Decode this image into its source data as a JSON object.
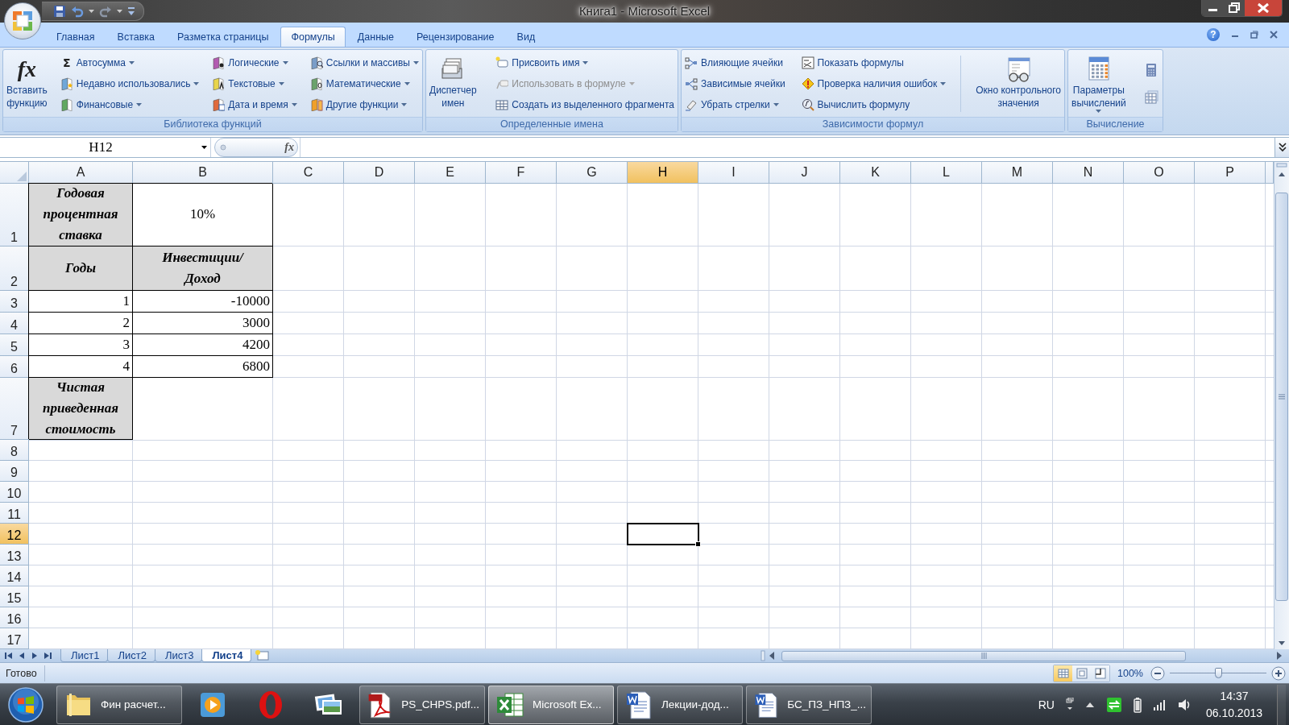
{
  "window": {
    "title": "Книга1 - Microsoft Excel"
  },
  "ribbon": {
    "help_glyph": "?",
    "tabs": [
      {
        "label": "Главная",
        "selected": false
      },
      {
        "label": "Вставка",
        "selected": false
      },
      {
        "label": "Разметка страницы",
        "selected": false
      },
      {
        "label": "Формулы",
        "selected": true
      },
      {
        "label": "Данные",
        "selected": false
      },
      {
        "label": "Рецензирование",
        "selected": false
      },
      {
        "label": "Вид",
        "selected": false
      }
    ],
    "groups": [
      {
        "title": "Библиотека функций",
        "parts": [
          {
            "kind": "large",
            "label": "Вставить\nфункцию",
            "glyph": "fx",
            "dropdown": false
          },
          {
            "kind": "column",
            "items": [
              {
                "label": "Автосумма",
                "glyph": "Σ",
                "dropdown": true,
                "disabled": false
              },
              {
                "label": "Недавно использовались",
                "dropdown": true,
                "disabled": false
              },
              {
                "label": "Финансовые",
                "dropdown": true,
                "disabled": false
              }
            ]
          },
          {
            "kind": "column",
            "items": [
              {
                "label": "Логические",
                "dropdown": true,
                "disabled": false
              },
              {
                "label": "Текстовые",
                "dropdown": true,
                "disabled": false
              },
              {
                "label": "Дата и время",
                "dropdown": true,
                "disabled": false
              }
            ]
          },
          {
            "kind": "column",
            "items": [
              {
                "label": "Ссылки и массивы",
                "dropdown": true,
                "disabled": false
              },
              {
                "label": "Математические",
                "dropdown": true,
                "disabled": false
              },
              {
                "label": "Другие функции",
                "dropdown": true,
                "disabled": false
              }
            ]
          }
        ]
      },
      {
        "title": "Определенные имена",
        "parts": [
          {
            "kind": "large",
            "label": "Диспетчер\nимен",
            "dropdown": false
          },
          {
            "kind": "column",
            "items": [
              {
                "label": "Присвоить имя",
                "dropdown": true,
                "disabled": false
              },
              {
                "label": "Использовать в формуле",
                "dropdown": true,
                "disabled": true
              },
              {
                "label": "Создать из выделенного фрагмента",
                "dropdown": false,
                "disabled": false
              }
            ]
          }
        ]
      },
      {
        "title": "Зависимости формул",
        "parts": [
          {
            "kind": "column",
            "items": [
              {
                "label": "Влияющие ячейки",
                "dropdown": false,
                "disabled": false
              },
              {
                "label": "Зависимые ячейки",
                "dropdown": false,
                "disabled": false
              },
              {
                "label": "Убрать стрелки",
                "dropdown": true,
                "disabled": false
              }
            ]
          },
          {
            "kind": "column",
            "items": [
              {
                "label": "Показать формулы",
                "dropdown": false,
                "disabled": false
              },
              {
                "label": "Проверка наличия ошибок",
                "dropdown": true,
                "disabled": false
              },
              {
                "label": "Вычислить формулу",
                "dropdown": false,
                "disabled": false
              }
            ]
          },
          {
            "kind": "separator"
          },
          {
            "kind": "large",
            "label": "Окно контрольного\nзначения",
            "dropdown": false
          }
        ]
      },
      {
        "title": "Вычисление",
        "parts": [
          {
            "kind": "large",
            "label": "Параметры\nвычислений",
            "dropdown": true
          },
          {
            "kind": "icons",
            "items": [
              {
                "kind": "calculator"
              },
              {
                "kind": "sheet"
              }
            ]
          }
        ]
      }
    ]
  },
  "formula_bar": {
    "name_box": "H12",
    "fx_glyph": "fx"
  },
  "sheet": {
    "columns": [
      {
        "label": "A",
        "selected": false
      },
      {
        "label": "B",
        "selected": false
      },
      {
        "label": "C",
        "selected": false
      },
      {
        "label": "D",
        "selected": false
      },
      {
        "label": "E",
        "selected": false
      },
      {
        "label": "F",
        "selected": false
      },
      {
        "label": "G",
        "selected": false
      },
      {
        "label": "H",
        "selected": true
      },
      {
        "label": "I",
        "selected": false
      },
      {
        "label": "J",
        "selected": false
      },
      {
        "label": "K",
        "selected": false
      },
      {
        "label": "L",
        "selected": false
      },
      {
        "label": "M",
        "selected": false
      },
      {
        "label": "N",
        "selected": false
      },
      {
        "label": "O",
        "selected": false
      },
      {
        "label": "P",
        "selected": false
      }
    ],
    "rows": [
      {
        "label": "1",
        "selected": false,
        "cells": [
          {
            "kind": "heading",
            "text": "Годовая процентная ставка"
          },
          {
            "kind": "text",
            "text": "10%"
          }
        ]
      },
      {
        "label": "2",
        "selected": false,
        "cells": [
          {
            "kind": "heading",
            "text": "Годы"
          },
          {
            "kind": "heading",
            "text": "Инвестиции/ Доход"
          }
        ]
      },
      {
        "label": "3",
        "selected": false,
        "cells": [
          {
            "kind": "number",
            "text": "1"
          },
          {
            "kind": "number",
            "text": "-10000"
          }
        ]
      },
      {
        "label": "4",
        "selected": false,
        "cells": [
          {
            "kind": "number",
            "text": "2"
          },
          {
            "kind": "number",
            "text": "3000"
          }
        ]
      },
      {
        "label": "5",
        "selected": false,
        "cells": [
          {
            "kind": "number",
            "text": "3"
          },
          {
            "kind": "number",
            "text": "4200"
          }
        ]
      },
      {
        "label": "6",
        "selected": false,
        "cells": [
          {
            "kind": "number",
            "text": "4"
          },
          {
            "kind": "number",
            "text": "6800"
          }
        ]
      },
      {
        "label": "7",
        "selected": false,
        "cells": [
          {
            "kind": "heading",
            "text": "Чистая приведенная стоимость"
          }
        ]
      },
      {
        "label": "8",
        "selected": false
      },
      {
        "label": "9",
        "selected": false
      },
      {
        "label": "10",
        "selected": false
      },
      {
        "label": "11",
        "selected": false
      },
      {
        "label": "12",
        "selected": true
      },
      {
        "label": "13",
        "selected": false
      },
      {
        "label": "14",
        "selected": false
      },
      {
        "label": "15",
        "selected": false
      },
      {
        "label": "16",
        "selected": false
      },
      {
        "label": "17",
        "selected": false
      }
    ]
  },
  "sheet_tabs": [
    {
      "label": "Лист1",
      "selected": false
    },
    {
      "label": "Лист2",
      "selected": false
    },
    {
      "label": "Лист3",
      "selected": false
    },
    {
      "label": "Лист4",
      "selected": true
    }
  ],
  "status_bar": {
    "text": "Готово",
    "views": [
      {
        "kind": "normal",
        "selected": true
      },
      {
        "kind": "page_layout",
        "selected": false
      },
      {
        "kind": "page_break",
        "selected": false
      }
    ],
    "zoom": {
      "label": "100%",
      "level": 0.5
    }
  },
  "taskbar": {
    "items": [
      {
        "kind": "folder",
        "label": "Фин расчет...",
        "selected": false
      },
      {
        "kind": "media",
        "selected": false
      },
      {
        "kind": "opera",
        "selected": false
      },
      {
        "kind": "photos",
        "selected": false
      },
      {
        "kind": "pdf",
        "label": "PS_CHPS.pdf...",
        "selected": false
      },
      {
        "kind": "excel",
        "label": "Microsoft Ex...",
        "selected": true
      },
      {
        "kind": "word",
        "label": "Лекции-дод...",
        "selected": false
      },
      {
        "kind": "word",
        "label": "БС_ПЗ_НПЗ_...",
        "selected": false
      }
    ],
    "tray": {
      "language": "RU",
      "time": "14:37",
      "date": "06.10.2013"
    }
  }
}
